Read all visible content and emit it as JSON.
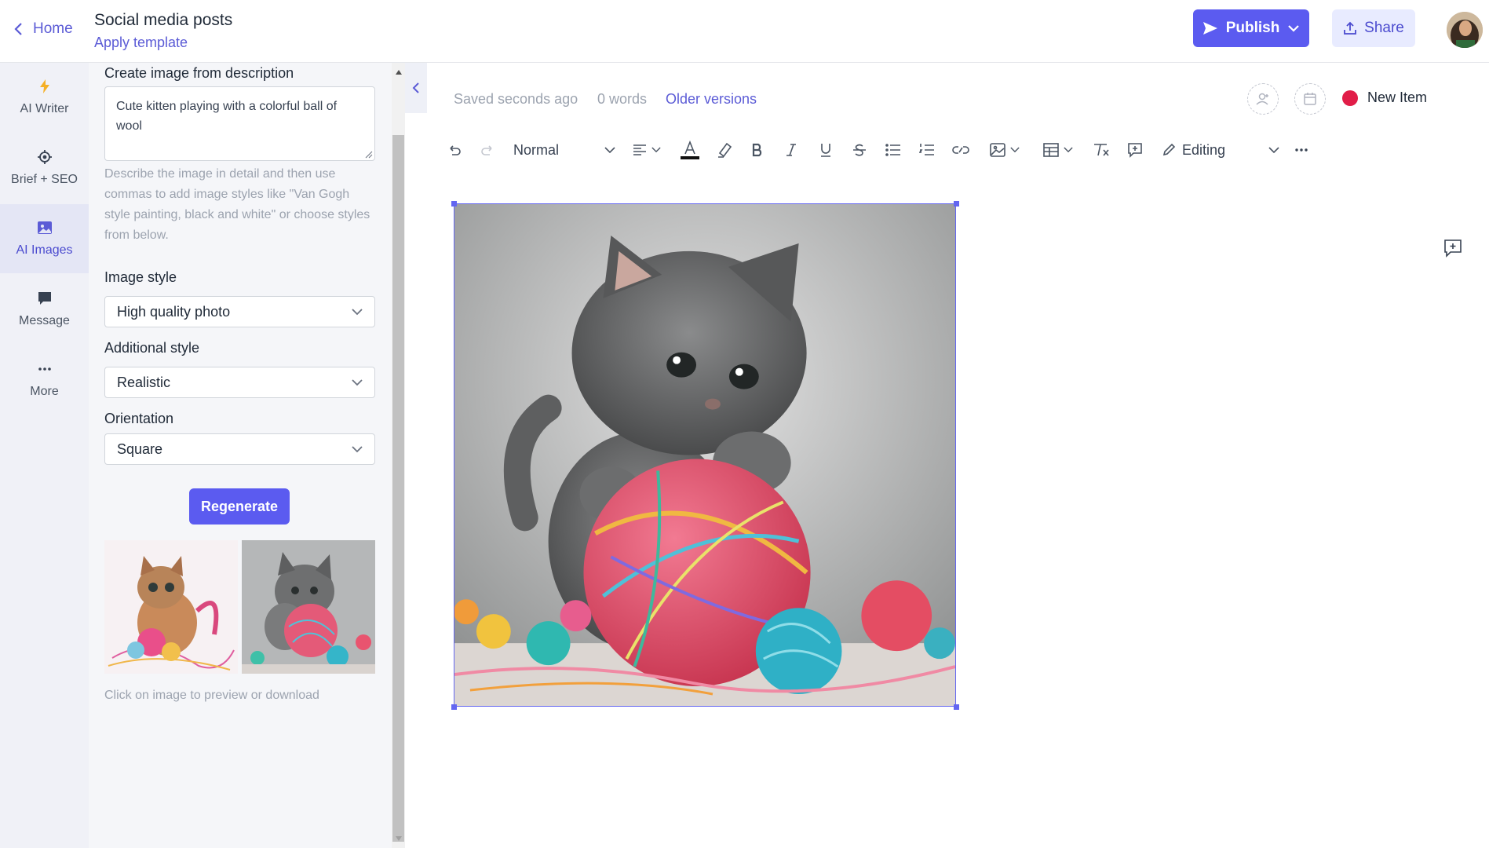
{
  "header": {
    "back_label": "Home",
    "doc_title": "Social media posts",
    "apply_template": "Apply template",
    "publish_label": "Publish",
    "share_label": "Share"
  },
  "rail": {
    "items": [
      {
        "label": "AI Writer",
        "icon": "bolt-icon"
      },
      {
        "label": "Brief + SEO",
        "icon": "target-icon"
      },
      {
        "label": "AI Images",
        "icon": "image-icon"
      },
      {
        "label": "Message",
        "icon": "chat-icon"
      },
      {
        "label": "More",
        "icon": "ellipsis-icon"
      }
    ],
    "active": "AI Images"
  },
  "panel": {
    "description_label": "Create image from description",
    "description_value": "Cute kitten playing with a colorful ball of wool",
    "help_text": "Describe the image in detail and then use commas to add image styles like \"Van Gogh style painting, black and white\" or choose styles from below.",
    "image_style_label": "Image style",
    "image_style_value": "High quality photo",
    "additional_style_label": "Additional style",
    "additional_style_value": "Realistic",
    "orientation_label": "Orientation",
    "orientation_value": "Square",
    "regenerate_label": "Regenerate",
    "hint": "Click on image to preview or download"
  },
  "editor": {
    "saved_status": "Saved seconds ago",
    "word_count": "0 words",
    "older_versions": "Older versions",
    "new_item": "New Item",
    "paragraph_style": "Normal",
    "mode": "Editing"
  },
  "colors": {
    "accent": "#5b5bf0",
    "status_dot": "#e11d48"
  }
}
